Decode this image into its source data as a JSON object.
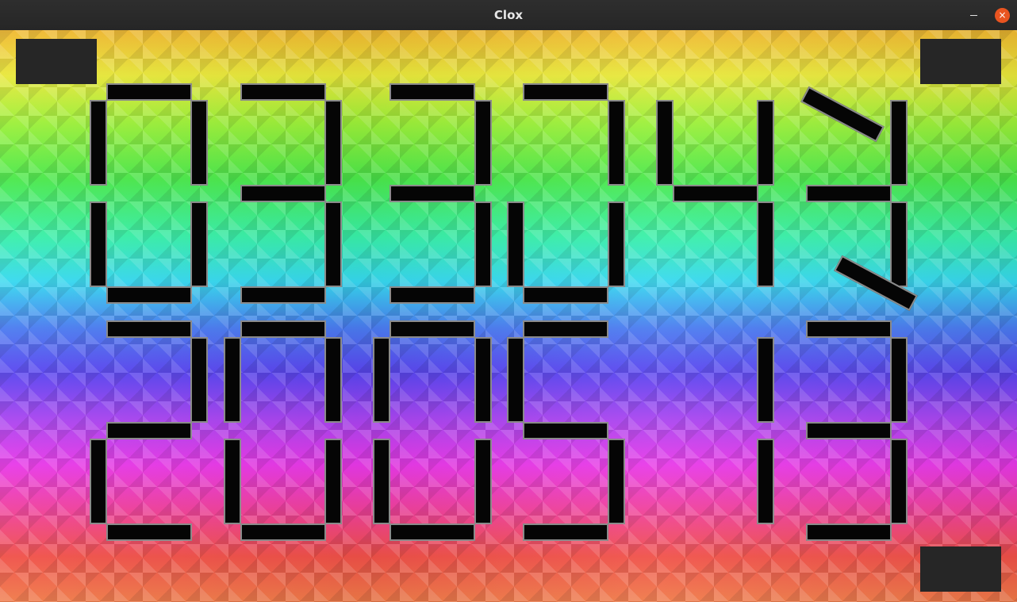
{
  "window": {
    "title": "Clox",
    "controls": {
      "minimize": "–",
      "close": "×"
    }
  },
  "colors": {
    "segment_fill": "#050505",
    "segment_border": "#8a8a8a",
    "corner_panel": "#262626",
    "close_button": "#e95420"
  },
  "icons": {
    "minimize": "minimize-icon",
    "close": "close-icon"
  },
  "clock_face": {
    "rows": 2,
    "digits_per_row": 6,
    "segment_states": [
      "off",
      "moving",
      "transitioning"
    ]
  }
}
